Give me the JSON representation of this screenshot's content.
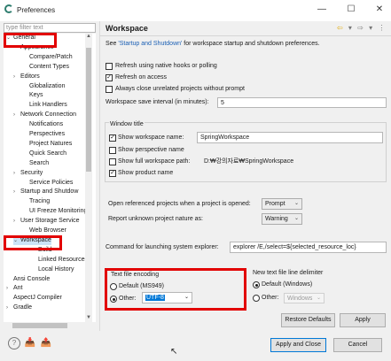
{
  "window": {
    "title": "Preferences",
    "minimize": "—",
    "maximize": "☐",
    "close": "✕"
  },
  "filter": {
    "placeholder": "type filter text"
  },
  "tree": [
    {
      "label": "General",
      "indent": 0,
      "arrow": "⌄"
    },
    {
      "label": "Appearance",
      "indent": 1,
      "arrow": ""
    },
    {
      "label": "Compare/Patch",
      "indent": 2,
      "arrow": ""
    },
    {
      "label": "Content Types",
      "indent": 2,
      "arrow": ""
    },
    {
      "label": "Editors",
      "indent": 1,
      "arrow": "›"
    },
    {
      "label": "Globalization",
      "indent": 2,
      "arrow": ""
    },
    {
      "label": "Keys",
      "indent": 2,
      "arrow": ""
    },
    {
      "label": "Link Handlers",
      "indent": 2,
      "arrow": ""
    },
    {
      "label": "Network Connection",
      "indent": 1,
      "arrow": "›"
    },
    {
      "label": "Notifications",
      "indent": 2,
      "arrow": ""
    },
    {
      "label": "Perspectives",
      "indent": 2,
      "arrow": ""
    },
    {
      "label": "Project Natures",
      "indent": 2,
      "arrow": ""
    },
    {
      "label": "Quick Search",
      "indent": 2,
      "arrow": ""
    },
    {
      "label": "Search",
      "indent": 2,
      "arrow": ""
    },
    {
      "label": "Security",
      "indent": 1,
      "arrow": "›"
    },
    {
      "label": "Service Policies",
      "indent": 2,
      "arrow": ""
    },
    {
      "label": "Startup and Shutdow",
      "indent": 1,
      "arrow": "›"
    },
    {
      "label": "Tracing",
      "indent": 2,
      "arrow": ""
    },
    {
      "label": "UI Freeze Monitoring",
      "indent": 2,
      "arrow": ""
    },
    {
      "label": "User Storage Service",
      "indent": 1,
      "arrow": "›"
    },
    {
      "label": "Web Browser",
      "indent": 2,
      "arrow": ""
    },
    {
      "label": "Workspace",
      "indent": 1,
      "arrow": "⌄"
    },
    {
      "label": "Build",
      "indent": 3,
      "arrow": ""
    },
    {
      "label": "Linked Resources",
      "indent": 3,
      "arrow": ""
    },
    {
      "label": "Local History",
      "indent": 3,
      "arrow": ""
    },
    {
      "label": "Ansi Console",
      "indent": 0,
      "arrow": ""
    },
    {
      "label": "Ant",
      "indent": 0,
      "arrow": "›"
    },
    {
      "label": "AspectJ Compiler",
      "indent": 0,
      "arrow": ""
    },
    {
      "label": "Gradle",
      "indent": 0,
      "arrow": "›"
    }
  ],
  "page": {
    "title": "Workspace",
    "intro_prefix": "See ",
    "intro_link": "'Startup and Shutdown'",
    "intro_suffix": " for workspace startup and shutdown preferences.",
    "refresh_native": "Refresh using native hooks or polling",
    "refresh_access": "Refresh on access",
    "always_close": "Always close unrelated projects without prompt",
    "save_interval_label": "Workspace save interval (in minutes):",
    "save_interval_value": "5",
    "window_title_group": "Window title",
    "show_ws_name": "Show workspace name:",
    "ws_name_value": "SpringWorkspace",
    "show_perspective": "Show perspective name",
    "show_full_path": "Show full workspace path:",
    "full_path_value": "D:₩강의자료₩SpringWorkspace",
    "show_product": "Show product name",
    "open_ref_label": "Open referenced projects when a project is opened:",
    "open_ref_value": "Prompt",
    "report_unknown_label": "Report unknown project nature as:",
    "report_unknown_value": "Warning",
    "cmd_label": "Command for launching system explorer:",
    "cmd_value": "explorer /E,/select=${selected_resource_loc}",
    "encoding_group": "Text file encoding",
    "encoding_default": "Default (MS949)",
    "encoding_other": "Other:",
    "encoding_other_value": "UTF-8",
    "delim_group": "New text file line delimiter",
    "delim_default": "Default (Windows)",
    "delim_other": "Other:",
    "delim_other_value": "Windows",
    "restore_defaults": "Restore Defaults",
    "apply": "Apply"
  },
  "footer": {
    "apply_close": "Apply and Close",
    "cancel": "Cancel"
  },
  "colors": {
    "highlight": "#e20000",
    "link": "#1a5fb4",
    "selection": "#cce4f7"
  }
}
